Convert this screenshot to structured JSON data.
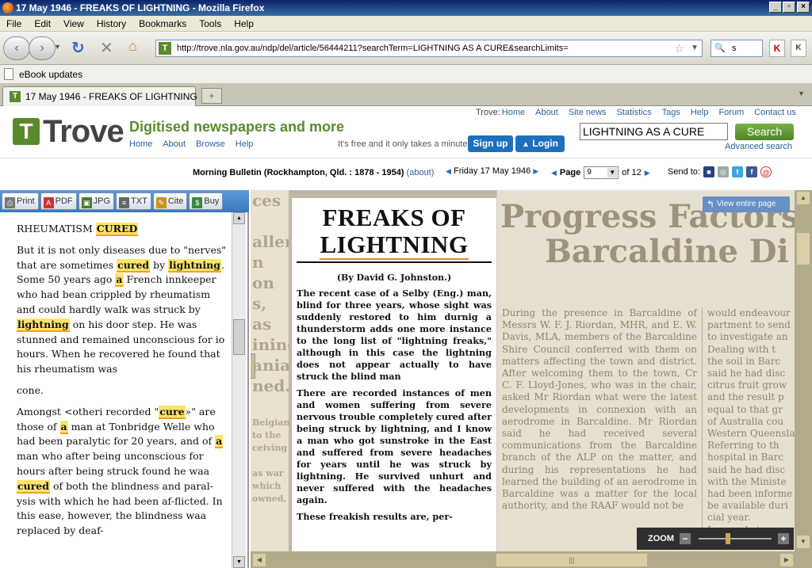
{
  "window": {
    "title": "17 May 1946 - FREAKS OF LIGHTNING - Mozilla Firefox"
  },
  "menu": [
    "File",
    "Edit",
    "View",
    "History",
    "Bookmarks",
    "Tools",
    "Help"
  ],
  "nav": {
    "url": "http://trove.nla.gov.au/ndp/del/article/56444211?searchTerm=LIGHTNING AS A CURE&searchLimits=",
    "search_value": "s"
  },
  "bookmarks": {
    "item": "eBook updates"
  },
  "tab": {
    "label": "17 May 1946 - FREAKS OF LIGHTNING"
  },
  "trove": {
    "logo_text": "Trove",
    "tagline": "Digitised newspapers and more",
    "left_links": [
      "Home",
      "About",
      "Browse",
      "Help"
    ],
    "top_label": "Trove:",
    "top_links": [
      "Home",
      "About",
      "Site news",
      "Statistics",
      "Tags",
      "Help",
      "Forum",
      "Contact us"
    ],
    "query": "LIGHTNING AS A CURE",
    "search_button": "Search",
    "advanced": "Advanced search",
    "free_text": "It's free and it only takes a minute",
    "signup": "Sign up",
    "login": "Login"
  },
  "crumb": {
    "publication": "Morning Bulletin (Rockhampton, Qld. : 1878 - 1954)",
    "about": "(about)",
    "date": "Friday 17 May 1946",
    "page_label": "Page",
    "page_value": "9",
    "page_of": "of 12",
    "send_to": "Send to:"
  },
  "tools": [
    "Print",
    "PDF",
    "JPG",
    "TXT",
    "Cite",
    "Buy"
  ],
  "article_text": {
    "p1_heading_a": "RHEUMATISM ",
    "p1_heading_hl": "CURED",
    "p2_a": "But it is not only diseases due to \"nerves\" that are sometimes ",
    "p2_hl1": "cured",
    "p2_b": " by ",
    "p2_hl2": "lightning",
    "p2_c": ". Some 50 years ago ",
    "p2_hl3": "a",
    "p2_d": " French innkeeper who had bean crippled by rheumatism and could hardly walk was struck by ",
    "p2_hl4": "lightning",
    "p2_e": " on his door step. He was stunned and remained unconscious for io hours. When he recovered he found that his rheumatism was",
    "p3": "cone.",
    "p4_a": "Amongst <otheri recorded \"",
    "p4_hl1": "cure",
    "p4_b": "»\" are those of ",
    "p4_hl2": "a",
    "p4_c": " man at Tonbridge Welle who had been paralytic for 20 years, and of ",
    "p4_hl3": "a",
    "p4_d": " man who after being unconscious for hours after being struck found he waa ",
    "p4_hl4": "cured",
    "p4_e": " of both the blindness and paral-ysis with which he had been af-flicted. In this ease, however, the blindness waa replaced by deaf-"
  },
  "scan": {
    "headline_1": "FREAKS OF",
    "headline_2": "LIGHTNING",
    "byline": "(By David G. Johnston.)",
    "lead": "The recent case of a Selby (Eng.) man, blind for three years, whose sight was suddenly restored to him durnig a thunderstorm adds one more instance to the long list of \"lightning freaks,\" although in this case the lightning does not appear actually to have struck the blind man",
    "body": "There are recorded instances of men and women suffering from severe nervous trouble completely cured after being struck by lightning, and I know a man who got sunstroke in the East and suffered from severe headaches for years until he was struck by lightning. He survived unhurt and never suffered with the headaches again.",
    "body2": "These freakish results are, per-",
    "left_strip": [
      "ces",
      "",
      "allen",
      "n on",
      "s, as",
      "ining",
      "anian",
      "ned.",
      "",
      "Beigian",
      "to the",
      "ceiving",
      "",
      "as war",
      "which",
      "owned,"
    ],
    "right_title_1": "Progress Factors",
    "right_title_2": "Barcaldine Di",
    "right_col1": "During the presence in Barcaldine of Messrs W. F. J. Riordan, MHR, and E. W. Davis, MLA, members of the Barcaldine Shire Council conferred with them on matters affecting the town and district. After welcoming them to the town, Cr C. F. Lloyd-Jones, who was in the chair, asked Mr Riordan what were the latest developments in connexion with an aerodrome in Barcaldine. Mr Riordan said he had received several communications from the Barcaldine branch of the ALP on the matter, and during his representations he had learned the building of an aerodrome in Barcaldine was a matter for the local authority, and the RAAF would not be",
    "right_col2": [
      "would endeavour",
      "partment to send",
      "to investigate an",
      "   Dealing with t",
      "the soil in Barc",
      "said he had disc",
      "citrus fruit grow",
      "and the result p",
      "equal to that gr",
      "of Australia cou",
      "Western Queensla",
      "   Referring to th",
      "hospital in Barc",
      "said he had disc",
      "with the Ministe",
      "had been informe",
      "be available duri",
      "cial year.",
      "   In a reply to"
    ],
    "view_entire": "View entire page",
    "zoom_label": "ZOOM"
  }
}
